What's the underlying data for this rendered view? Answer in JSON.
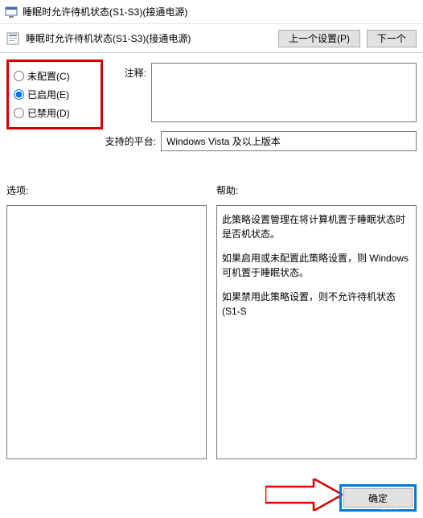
{
  "window": {
    "title": "睡眠时允许待机状态(S1-S3)(接通电源)"
  },
  "header": {
    "title": "睡眠时允许待机状态(S1-S3)(接通电源)",
    "prev_btn": "上一个设置(P)",
    "next_btn": "下一个"
  },
  "radio": {
    "not_configured": "未配置(C)",
    "enabled": "已启用(E)",
    "disabled": "已禁用(D)",
    "selected": "enabled"
  },
  "labels": {
    "comment": "注释:",
    "platform": "支持的平台:",
    "options": "选项:",
    "help": "帮助:"
  },
  "platform_value": "Windows Vista 及以上版本",
  "help_text": {
    "p1": "此策略设置管理在将计算机置于睡眠状态时是否机状态。",
    "p2": "如果启用或未配置此策略设置，则 Windows 可机置于睡眠状态。",
    "p3": "如果禁用此策略设置，则不允许待机状态(S1-S"
  },
  "buttons": {
    "ok": "确定"
  },
  "watermark": "Baidu经验"
}
